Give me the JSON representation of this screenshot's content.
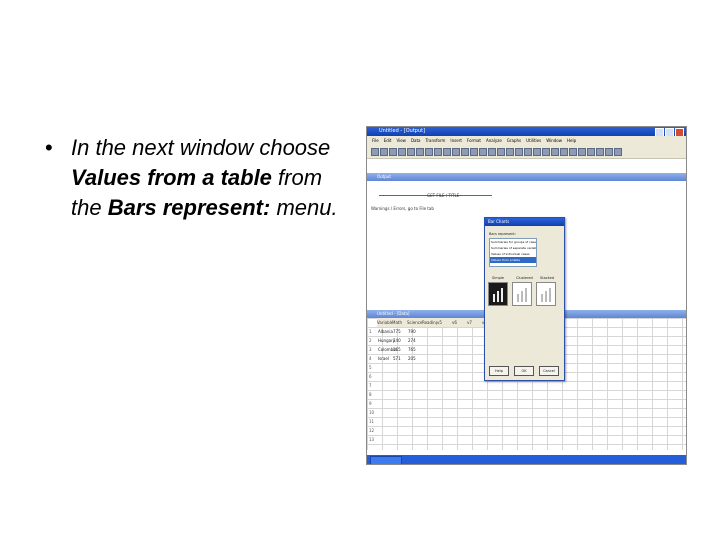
{
  "slide": {
    "bullet_symbol": "•",
    "text_parts": {
      "p1": "In the next window choose ",
      "b1": "Values from a table",
      "p2": " from the ",
      "b2": "Bars represent:",
      "p3": " menu."
    }
  },
  "screenshot": {
    "app_title": "Untitled - [Output]",
    "menu_items": [
      "File",
      "Edit",
      "View",
      "Data",
      "Transform",
      "Insert",
      "Format",
      "Analyze",
      "Graphs",
      "Utilities",
      "Window",
      "Help"
    ],
    "output_window_title": "Output",
    "output_heading": "GET FILE / TITLE",
    "output_text": "Warnings / Errors, go to File tab",
    "data_window_title": "Untitled - [Data]",
    "columns": [
      "Variable",
      "Math",
      "Science",
      "Reading",
      "v5",
      "v6",
      "v7",
      "v8"
    ],
    "rows": [
      [
        "Albania",
        "775",
        "790"
      ],
      [
        "Hungary",
        "240",
        "274"
      ],
      [
        "Colombia",
        "165",
        "765"
      ],
      [
        "Israel",
        "571",
        "205"
      ]
    ],
    "dialog": {
      "title": "Bar Charts",
      "label": "Bars represent:",
      "list_items": [
        "Summaries for groups of cases",
        "Summaries of separate variables",
        "Values of individual cases",
        "Values from a table"
      ],
      "selected_index": 3,
      "chart_types": [
        "Simple",
        "Clustered",
        "Stacked"
      ],
      "buttons": [
        "Help",
        "OK",
        "Cancel"
      ]
    },
    "taskbar_item": "start"
  }
}
